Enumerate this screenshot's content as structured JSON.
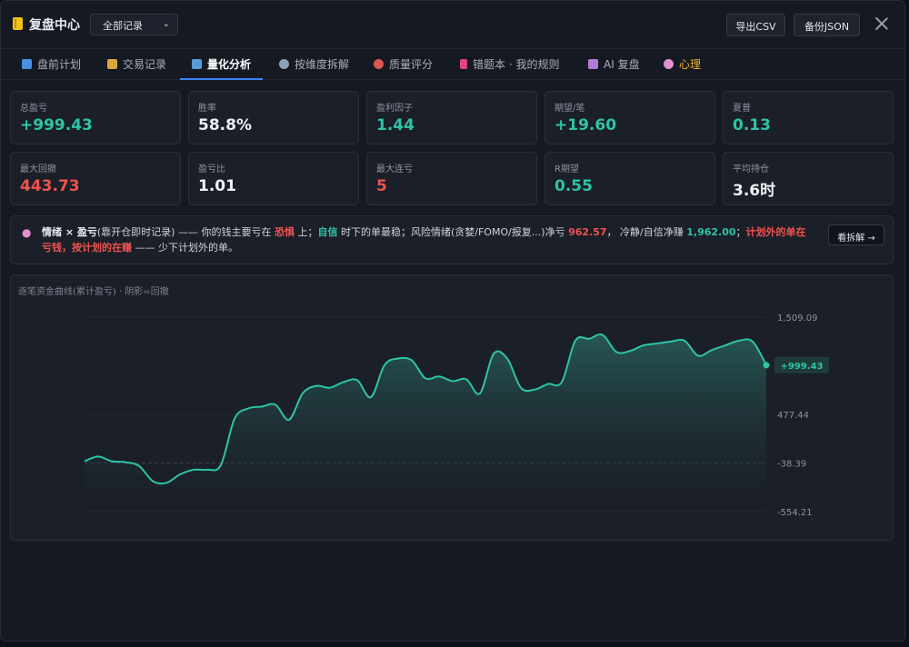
{
  "header": {
    "title": "复盘中心",
    "record_select": "全部记录",
    "export_csv": "导出CSV",
    "backup_json": "备份JSON"
  },
  "tabs": [
    {
      "label": "盘前计划",
      "icon": "calendar-icon",
      "color": "#4a90e2"
    },
    {
      "label": "交易记录",
      "icon": "clipboard-icon",
      "color": "#d9a441"
    },
    {
      "label": "量化分析",
      "icon": "bar-chart-icon",
      "color": "#5b9bd5"
    },
    {
      "label": "按维度拆解",
      "icon": "microscope-icon",
      "color": "#8fa3b8"
    },
    {
      "label": "质量评分",
      "icon": "target-icon",
      "color": "#e05555"
    },
    {
      "label": "错题本 · 我的规则",
      "icon": "book-icon",
      "color": "#e0457b"
    },
    {
      "label": "AI 复盘",
      "icon": "robot-icon",
      "color": "#b07ad9"
    },
    {
      "label": "心理",
      "icon": "brain-icon",
      "color": "#e48fd0"
    }
  ],
  "stats": [
    {
      "label": "总盈亏",
      "value": "+999.43",
      "tone": "teal"
    },
    {
      "label": "胜率",
      "value": "58.8%",
      "tone": "white"
    },
    {
      "label": "盈利因子",
      "value": "1.44",
      "tone": "teal"
    },
    {
      "label": "期望/笔",
      "value": "+19.60",
      "tone": "teal"
    },
    {
      "label": "夏普",
      "value": "0.13",
      "tone": "teal"
    },
    {
      "label": "最大回撤",
      "value": "443.73",
      "tone": "red"
    },
    {
      "label": "盈亏比",
      "value": "1.01",
      "tone": "white"
    },
    {
      "label": "最大连亏",
      "value": "5",
      "tone": "red"
    },
    {
      "label": "R期望",
      "value": "0.55",
      "tone": "teal"
    },
    {
      "label": "平均持仓",
      "value": "3.6时",
      "tone": "white"
    }
  ],
  "insight": {
    "p1": "情绪 × 盈亏",
    "p2": "(靠开仓即时记录) —— 你的钱主要亏在 ",
    "p3": "恐惧",
    "p4": " 上；",
    "p5": "自信",
    "p6": " 时下的单最稳；风险情绪(贪婪/FOMO/报复...)净亏 ",
    "p7": "962.57",
    "p8": "， 冷静/自信净赚 ",
    "p9": "1,962.00",
    "p10": "；",
    "p11": "计划外的单在亏钱，按计划的在赚",
    "p12": " —— 少下计划外的单。",
    "button": "看拆解 →"
  },
  "chart_data": {
    "type": "area",
    "title": "逐笔资金曲线(累计盈亏) · 阴影=回撤",
    "y_ticks": [
      "1,509.09",
      "477.44",
      "-38.39",
      "-554.21"
    ],
    "ylim": [
      -554.21,
      1509.09
    ],
    "last_label": "+999.43",
    "y": [
      -20,
      30,
      -20,
      -30,
      -70,
      -230,
      -250,
      -160,
      -110,
      -110,
      -60,
      430,
      540,
      560,
      580,
      420,
      700,
      780,
      760,
      820,
      840,
      660,
      1000,
      1070,
      1050,
      860,
      880,
      830,
      850,
      700,
      1120,
      1070,
      760,
      740,
      800,
      820,
      1260,
      1280,
      1320,
      1140,
      1150,
      1210,
      1230,
      1250,
      1260,
      1100,
      1160,
      1210,
      1260,
      1250,
      999.43
    ]
  }
}
